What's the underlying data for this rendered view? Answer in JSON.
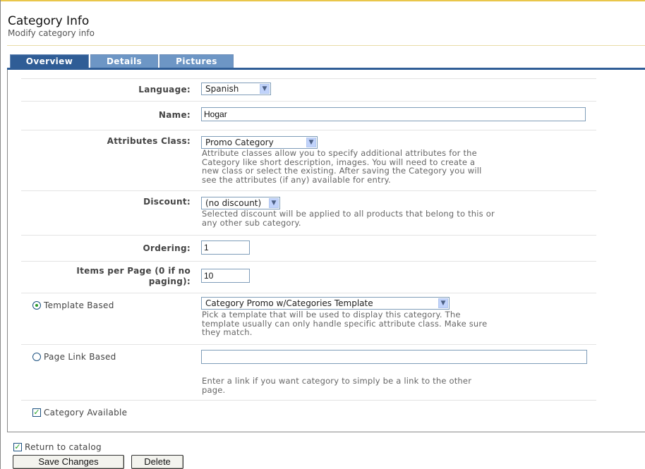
{
  "header": {
    "title": "Category Info",
    "subtitle": "Modify category info"
  },
  "tabs": [
    {
      "label": "Overview",
      "active": true
    },
    {
      "label": "Details",
      "active": false
    },
    {
      "label": "Pictures",
      "active": false
    }
  ],
  "form": {
    "language": {
      "label": "Language:",
      "value": "Spanish"
    },
    "name": {
      "label": "Name:",
      "value": "Hogar"
    },
    "attributes_class": {
      "label": "Attributes Class:",
      "value": "Promo Category",
      "help_lines": [
        "Attribute classes allow you to specify additional attributes for the",
        "Category like short description, images. You will need to create a",
        "new class or select the existing. After saving the Category you will",
        "see the attributes (if any) available for entry."
      ]
    },
    "discount": {
      "label": "Discount:",
      "value": "(no discount)",
      "help_lines": [
        "Selected discount will be applied to all products that belong to this or",
        "any other sub category."
      ]
    },
    "ordering": {
      "label": "Ordering:",
      "value": "1"
    },
    "items_per_page": {
      "label_line1": "Items per Page (0 if no",
      "label_line2": "paging):",
      "value": "10"
    },
    "template_based": {
      "label": "Template Based",
      "selected": true,
      "value": "Category Promo w/Categories Template",
      "help_lines": [
        "Pick a template that will be used to display this category. The",
        "template usually can only handle specific attribute class. Make sure",
        "they match."
      ]
    },
    "page_link_based": {
      "label": "Page Link Based",
      "selected": false,
      "value": "",
      "help_lines": [
        "Enter a link if you want category to simply be a link to the other",
        "page."
      ]
    },
    "category_available": {
      "label": "Category Available",
      "checked": true
    }
  },
  "footer": {
    "return_to_catalog": {
      "label": "Return to catalog",
      "checked": true
    },
    "save_label": "Save Changes",
    "delete_label": "Delete"
  },
  "colors": {
    "tab_active": "#2f5d96",
    "tab_inactive": "#6d96c5",
    "header_accent": "#e9c64a"
  },
  "icons": {
    "dropdown": "chevron-down-icon",
    "check": "checkmark-icon"
  }
}
